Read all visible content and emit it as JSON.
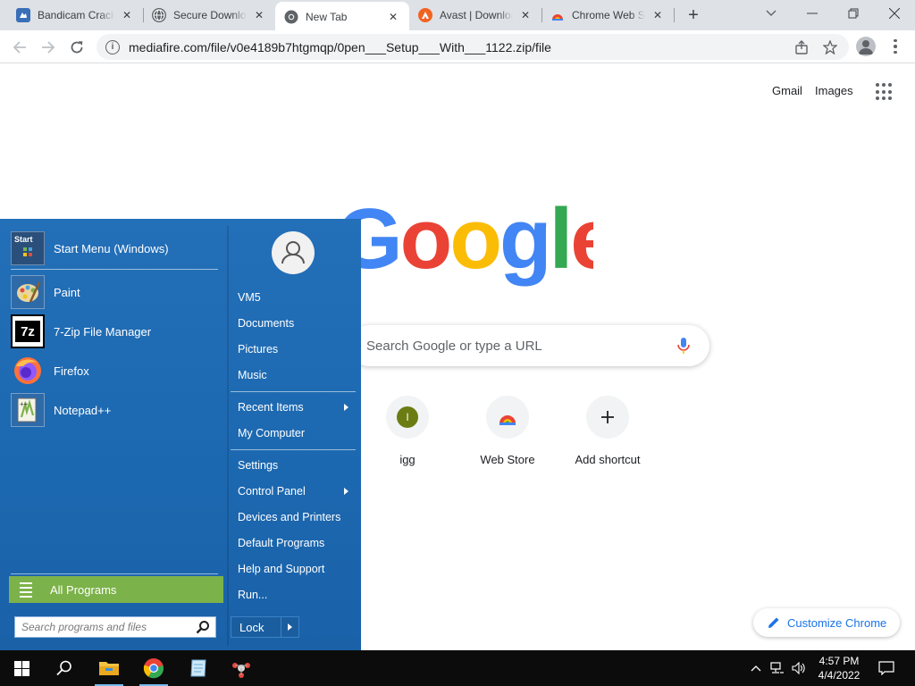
{
  "browser": {
    "tabs": [
      {
        "title": "Bandicam Crack",
        "icon": "bandicam-icon",
        "active": false
      },
      {
        "title": "Secure Download",
        "icon": "globe-icon",
        "active": false
      },
      {
        "title": "New Tab",
        "icon": "chrome-icon",
        "active": true
      },
      {
        "title": "Avast | Download",
        "icon": "avast-icon",
        "active": false
      },
      {
        "title": "Chrome Web Store",
        "icon": "web-store-icon",
        "active": false
      }
    ],
    "new_tab_symbol": "+",
    "url": "mediafire.com/file/v0e4189b7htgmqp/0pen___Setup___With___1122.zip/file"
  },
  "ntp": {
    "gmail": "Gmail",
    "images": "Images",
    "search_placeholder": "Search Google or type a URL",
    "shortcuts": [
      {
        "label": "igg",
        "letter": "I",
        "color": "#6b7c13"
      },
      {
        "label": "Web Store",
        "icon": "web-store-icon"
      },
      {
        "label": "Add shortcut",
        "icon": "plus-icon"
      }
    ],
    "customize": "Customize Chrome"
  },
  "start_menu": {
    "programs": [
      {
        "label": "Start Menu (Windows)",
        "icon": "start-menu-app-icon",
        "tile_text": "Start"
      },
      {
        "label": "Paint",
        "icon": "paint-icon"
      },
      {
        "label": "7-Zip File Manager",
        "icon": "7zip-icon",
        "tile_text": "7z"
      },
      {
        "label": "Firefox",
        "icon": "firefox-icon"
      },
      {
        "label": "Notepad++",
        "icon": "notepadpp-icon"
      }
    ],
    "all_programs": "All Programs",
    "search_placeholder": "Search programs and files",
    "right_items": [
      {
        "label": "VM5"
      },
      {
        "label": "Documents"
      },
      {
        "label": "Pictures"
      },
      {
        "label": "Music"
      },
      {
        "label": "Recent Items",
        "submenu": true
      },
      {
        "label": "My Computer"
      },
      {
        "label": "Settings"
      },
      {
        "label": "Control Panel",
        "submenu": true
      },
      {
        "label": "Devices and Printers"
      },
      {
        "label": "Default Programs"
      },
      {
        "label": "Help and Support"
      },
      {
        "label": "Run..."
      }
    ],
    "lock": "Lock"
  },
  "taskbar": {
    "time": "4:57 PM",
    "date": "4/4/2022"
  },
  "colors": {
    "start_menu_bg": "#1f6db4",
    "all_programs_bg": "#7cb24a",
    "accent_blue": "#1a73e8",
    "taskbar_bg": "#0c0c0c"
  }
}
